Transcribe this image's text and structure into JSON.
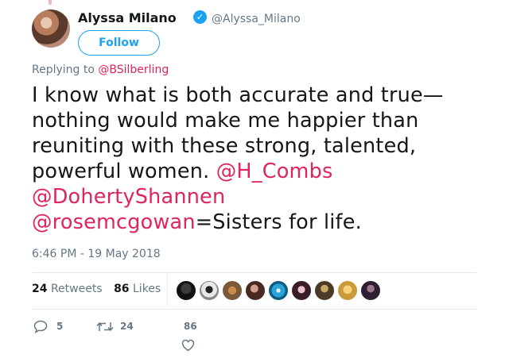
{
  "author": {
    "display_name": "Alyssa Milano",
    "handle": "@Alyssa_Milano",
    "verified_icon": "verified-badge-icon",
    "follow_label": "Follow"
  },
  "reply": {
    "prefix": "Replying to",
    "mention": "@BSilberling"
  },
  "tweet": {
    "line1": "I know what is both accurate and true—",
    "line2": "nothing would make me happier than",
    "line3": "reuniting with these strong, talented,",
    "line4_text": "powerful women. ",
    "line4_mention": "@H_Combs",
    "line5_mention": "@DohertyShannen",
    "line6_mention": "@rosemcgowan",
    "line6_text": "=Sisters for life."
  },
  "timestamp": "6:46 PM - 19 May 2018",
  "stats": {
    "retweets_count": "24",
    "retweets_label": "Retweets",
    "likes_count": "86",
    "likes_label": "Likes"
  },
  "actions": {
    "reply_count": "5",
    "retweet_count": "24",
    "like_count": "86"
  },
  "colors": {
    "mention": "#e0245e",
    "accent": "#1da1f2",
    "muted": "#657786"
  }
}
